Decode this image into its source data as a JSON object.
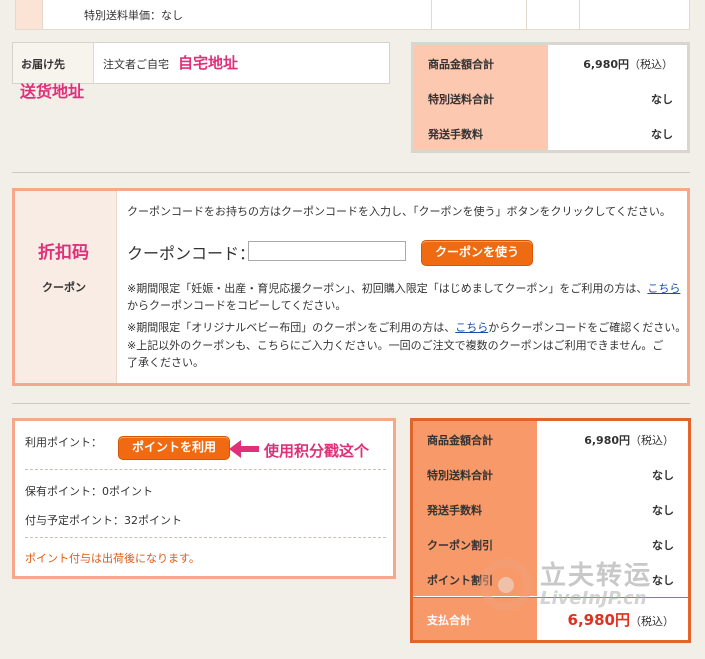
{
  "top_row": {
    "text": "特別送料単価：なし"
  },
  "delivery": {
    "label": "お届け先",
    "value": "注文者ご自宅"
  },
  "annotations": {
    "home_address": "自宅地址",
    "delivery_address": "送货地址",
    "coupon": "折扣码",
    "use_points": "使用积分戳这个"
  },
  "summary_top": {
    "rows": [
      {
        "label": "商品金額合計",
        "value": "6,980円",
        "suffix": "（税込）"
      },
      {
        "label": "特別送料合計",
        "value": "なし"
      },
      {
        "label": "発送手数料",
        "value": "なし"
      }
    ]
  },
  "coupon": {
    "label": "クーポン",
    "intro": "クーポンコードをお持ちの方はクーポンコードを入力し、「クーポンを使う」ボタンをクリックしてください。",
    "code_label": "クーポンコード：",
    "input_value": "",
    "button": "クーポンを使う",
    "note1_a": "※期間限定「妊娠・出産・育児応援クーポン」、初回購入限定「はじめましてクーポン」をご利用の方は、",
    "note1_link": "こちら",
    "note1_b": "からクーポンコードをコピーしてください。",
    "note2_a": "※期間限定「オリジナルベビー布団」のクーポンをご利用の方は、",
    "note2_link": "こちら",
    "note2_b": "からクーポンコードをご確認ください。",
    "note3_a": "※上記以外のクーポンも、こちらにご入力ください。一回のご注文で複数のクーポンはご利用できません。ご",
    "note3_b": "了承ください。"
  },
  "points": {
    "use_label": "利用ポイント：",
    "button": "ポイントを利用",
    "owned": "保有ポイント：0ポイント",
    "planned": "付与予定ポイント：32ポイント",
    "notice": "ポイント付与は出荷後になります。"
  },
  "summary_bottom": {
    "rows": [
      {
        "label": "商品金額合計",
        "value": "6,980円",
        "suffix": "（税込）"
      },
      {
        "label": "特別送料合計",
        "value": "なし"
      },
      {
        "label": "発送手数料",
        "value": "なし"
      },
      {
        "label": "クーポン割引",
        "value": "なし"
      },
      {
        "label": "ポイント割引",
        "value": "なし"
      }
    ],
    "total_label": "支払合計",
    "total_value": "6,980円",
    "total_suffix": "（税込）"
  },
  "watermark": {
    "cn": "立夫转运",
    "en": "LiveInJP.cn"
  },
  "colors": {
    "accent": "#f06a12",
    "annotation": "#e0307a",
    "total": "#e0301e"
  }
}
